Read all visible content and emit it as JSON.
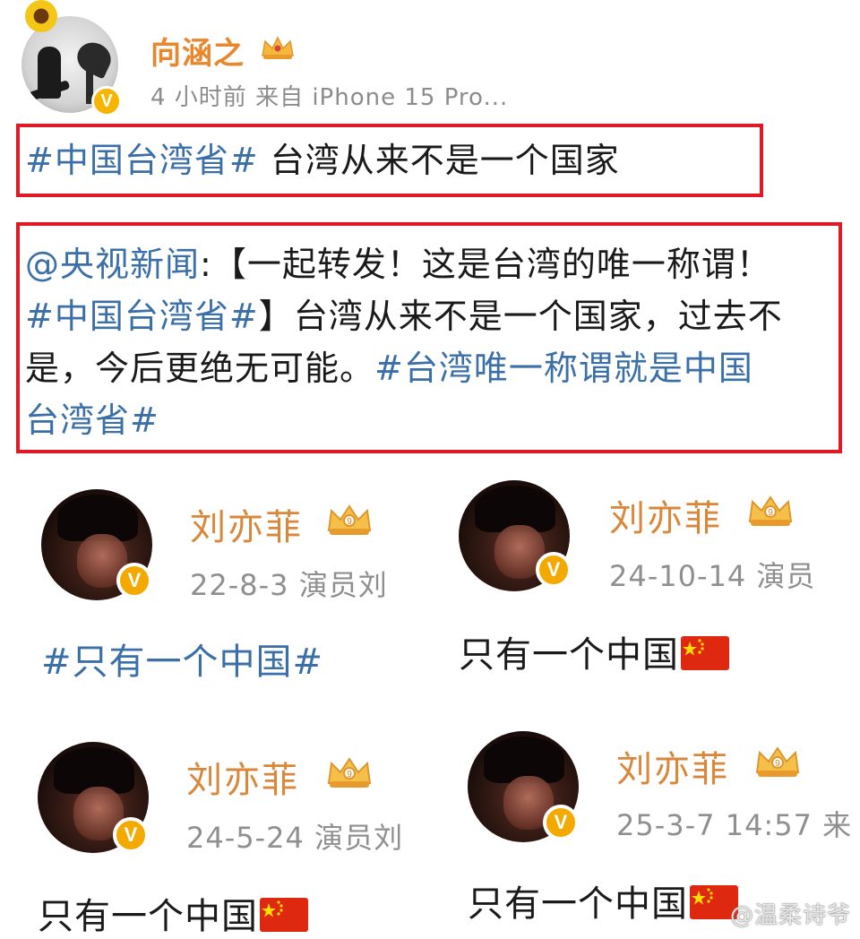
{
  "top_post": {
    "username": "向涵之",
    "meta": "4 小时前  来自 iPhone 15 Pro...",
    "line1_topic": "#中国台湾省#",
    "line1_text": " 台湾从来不是一个国家",
    "repost": {
      "mention": "@央视新闻",
      "seg1": ":【一起转发！这是台湾的唯一称谓！",
      "topic1": "#中国台湾省#",
      "seg2": "】台湾从来不是一个国家，过去不",
      "seg3": "是，今后更绝无可能。",
      "topic2a": "#台湾唯一称谓就是中国",
      "topic2b": "台湾省#"
    }
  },
  "posts": [
    {
      "name": "刘亦菲",
      "meta": "22-8-3  演员刘",
      "content_topic": "#只有一个中国#",
      "content_text": ""
    },
    {
      "name": "刘亦菲",
      "meta": "24-10-14  演员",
      "content_topic": "",
      "content_text": "只有一个中国"
    },
    {
      "name": "刘亦菲",
      "meta": "24-5-24  演员刘",
      "content_topic": "",
      "content_text": "只有一个中国"
    },
    {
      "name": "刘亦菲",
      "meta": "25-3-7 14:57  来",
      "content_topic": "",
      "content_text": "只有一个中国"
    }
  ],
  "badges": {
    "verified": "V",
    "crown_level": "9"
  },
  "watermark": "@温柔诗爷",
  "colors": {
    "topic": "#3b6fa8",
    "username": "#d9873a",
    "highlight_box": "#e01a24",
    "verified": "#f4a900"
  }
}
